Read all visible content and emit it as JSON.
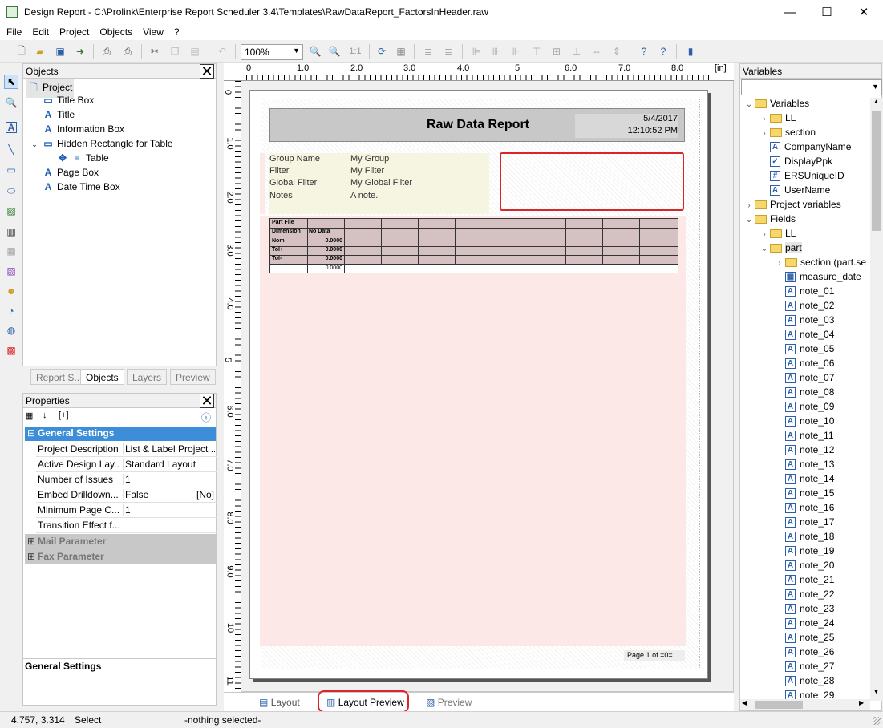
{
  "window": {
    "title": "Design Report - C:\\Prolink\\Enterprise Report Scheduler 3.4\\Templates\\RawDataReport_FactorsInHeader.raw",
    "min": "—",
    "max": "☐",
    "close": "✕"
  },
  "menu": [
    "File",
    "Edit",
    "Project",
    "Objects",
    "View",
    "?"
  ],
  "toolbar": {
    "zoom": "100%",
    "zoom_1to1": "1:1"
  },
  "objects_panel": {
    "title": "Objects",
    "items": [
      "Project",
      "Title Box",
      "Title",
      "Information Box",
      "Hidden Rectangle for Table",
      "Table",
      "Page Box",
      "Date Time Box"
    ],
    "tabs": [
      "Report S...",
      "Objects",
      "Layers",
      "Preview"
    ]
  },
  "properties_panel": {
    "title": "Properties",
    "group": "General Settings",
    "rows": [
      {
        "k": "Project Description",
        "v": "List & Label Project ..."
      },
      {
        "k": "Active Design Lay...",
        "v": "Standard Layout"
      },
      {
        "k": "Number of Issues",
        "v": "1"
      },
      {
        "k": "Embed Drilldown...",
        "v": "False",
        "extra": "[No]"
      },
      {
        "k": "Minimum Page C...",
        "v": "1"
      },
      {
        "k": "Transition Effect f...",
        "v": ""
      }
    ],
    "collapsed": [
      "Mail Parameter",
      "Fax Parameter"
    ],
    "footer": "General Settings"
  },
  "ruler": {
    "unit": "[in]",
    "h": [
      "0",
      "1.0",
      "2.0",
      "3.0",
      "4.0",
      "5",
      "6.0",
      "7.0",
      "8.0"
    ],
    "v": [
      "0",
      "1.0",
      "2.0",
      "3.0",
      "4.0",
      "5",
      "6.0",
      "7.0",
      "8.0",
      "9.0",
      "10",
      "11"
    ]
  },
  "report": {
    "title": "Raw Data Report",
    "date": "5/4/2017",
    "time": "12:10:52 PM",
    "info": [
      {
        "k": "Group Name",
        "v": "My Group"
      },
      {
        "k": "Filter",
        "v": "My Filter"
      },
      {
        "k": "Global Filter",
        "v": "My Global Filter"
      },
      {
        "k": "Notes",
        "v": "A note."
      }
    ],
    "table_rows": [
      {
        "k": "Part File",
        "v": ""
      },
      {
        "k": "Dimension",
        "v": "No Data"
      },
      {
        "k": "Nom",
        "v": "0.0000"
      },
      {
        "k": "Tol+",
        "v": "0.0000"
      },
      {
        "k": "Tol-",
        "v": "0.0000"
      },
      {
        "k": "",
        "v": "0.0000"
      }
    ],
    "page_footer": {
      "label": "Page",
      "num": "1",
      "of": "of",
      "total": "=0="
    }
  },
  "bottom_tabs": [
    "Layout",
    "Layout Preview",
    "Preview"
  ],
  "variables_panel": {
    "title": "Variables",
    "items": [
      {
        "d": 0,
        "t": "Variables",
        "i": "folder",
        "e": "v"
      },
      {
        "d": 1,
        "t": "LL",
        "i": "folder",
        "e": ">"
      },
      {
        "d": 1,
        "t": "section",
        "i": "folder",
        "e": ">"
      },
      {
        "d": 1,
        "t": "CompanyName",
        "i": "A",
        "e": ""
      },
      {
        "d": 1,
        "t": "DisplayPpk",
        "i": "✓",
        "e": ""
      },
      {
        "d": 1,
        "t": "ERSUniqueID",
        "i": "#",
        "e": ""
      },
      {
        "d": 1,
        "t": "UserName",
        "i": "A",
        "e": ""
      },
      {
        "d": 0,
        "t": "Project variables",
        "i": "folder",
        "e": ">"
      },
      {
        "d": 0,
        "t": "Fields",
        "i": "folder",
        "e": "v"
      },
      {
        "d": 1,
        "t": "LL",
        "i": "folder",
        "e": ">"
      },
      {
        "d": 1,
        "t": "part",
        "i": "folder",
        "e": "v"
      },
      {
        "d": 2,
        "t": "section (part.se",
        "i": "folder",
        "e": ">"
      },
      {
        "d": 2,
        "t": "measure_date",
        "i": "▦",
        "e": ""
      },
      {
        "d": 2,
        "t": "note_01",
        "i": "A",
        "e": ""
      },
      {
        "d": 2,
        "t": "note_02",
        "i": "A",
        "e": ""
      },
      {
        "d": 2,
        "t": "note_03",
        "i": "A",
        "e": ""
      },
      {
        "d": 2,
        "t": "note_04",
        "i": "A",
        "e": ""
      },
      {
        "d": 2,
        "t": "note_05",
        "i": "A",
        "e": ""
      },
      {
        "d": 2,
        "t": "note_06",
        "i": "A",
        "e": ""
      },
      {
        "d": 2,
        "t": "note_07",
        "i": "A",
        "e": ""
      },
      {
        "d": 2,
        "t": "note_08",
        "i": "A",
        "e": ""
      },
      {
        "d": 2,
        "t": "note_09",
        "i": "A",
        "e": ""
      },
      {
        "d": 2,
        "t": "note_10",
        "i": "A",
        "e": ""
      },
      {
        "d": 2,
        "t": "note_11",
        "i": "A",
        "e": ""
      },
      {
        "d": 2,
        "t": "note_12",
        "i": "A",
        "e": ""
      },
      {
        "d": 2,
        "t": "note_13",
        "i": "A",
        "e": ""
      },
      {
        "d": 2,
        "t": "note_14",
        "i": "A",
        "e": ""
      },
      {
        "d": 2,
        "t": "note_15",
        "i": "A",
        "e": ""
      },
      {
        "d": 2,
        "t": "note_16",
        "i": "A",
        "e": ""
      },
      {
        "d": 2,
        "t": "note_17",
        "i": "A",
        "e": ""
      },
      {
        "d": 2,
        "t": "note_18",
        "i": "A",
        "e": ""
      },
      {
        "d": 2,
        "t": "note_19",
        "i": "A",
        "e": ""
      },
      {
        "d": 2,
        "t": "note_20",
        "i": "A",
        "e": ""
      },
      {
        "d": 2,
        "t": "note_21",
        "i": "A",
        "e": ""
      },
      {
        "d": 2,
        "t": "note_22",
        "i": "A",
        "e": ""
      },
      {
        "d": 2,
        "t": "note_23",
        "i": "A",
        "e": ""
      },
      {
        "d": 2,
        "t": "note_24",
        "i": "A",
        "e": ""
      },
      {
        "d": 2,
        "t": "note_25",
        "i": "A",
        "e": ""
      },
      {
        "d": 2,
        "t": "note_26",
        "i": "A",
        "e": ""
      },
      {
        "d": 2,
        "t": "note_27",
        "i": "A",
        "e": ""
      },
      {
        "d": 2,
        "t": "note_28",
        "i": "A",
        "e": ""
      },
      {
        "d": 2,
        "t": "note_29",
        "i": "A",
        "e": ""
      }
    ]
  },
  "status": {
    "coords": "4.757, 3.314",
    "mode": "Select",
    "selection": "-nothing selected-"
  },
  "colors": {
    "highlight": "#d9262c",
    "title_bg": "#c8c8c8",
    "info_bg": "#f5f5e1",
    "table_bg": "#d5c1c1",
    "body_bg": "#fde8e8",
    "group_hdr": "#3d8ed8"
  }
}
